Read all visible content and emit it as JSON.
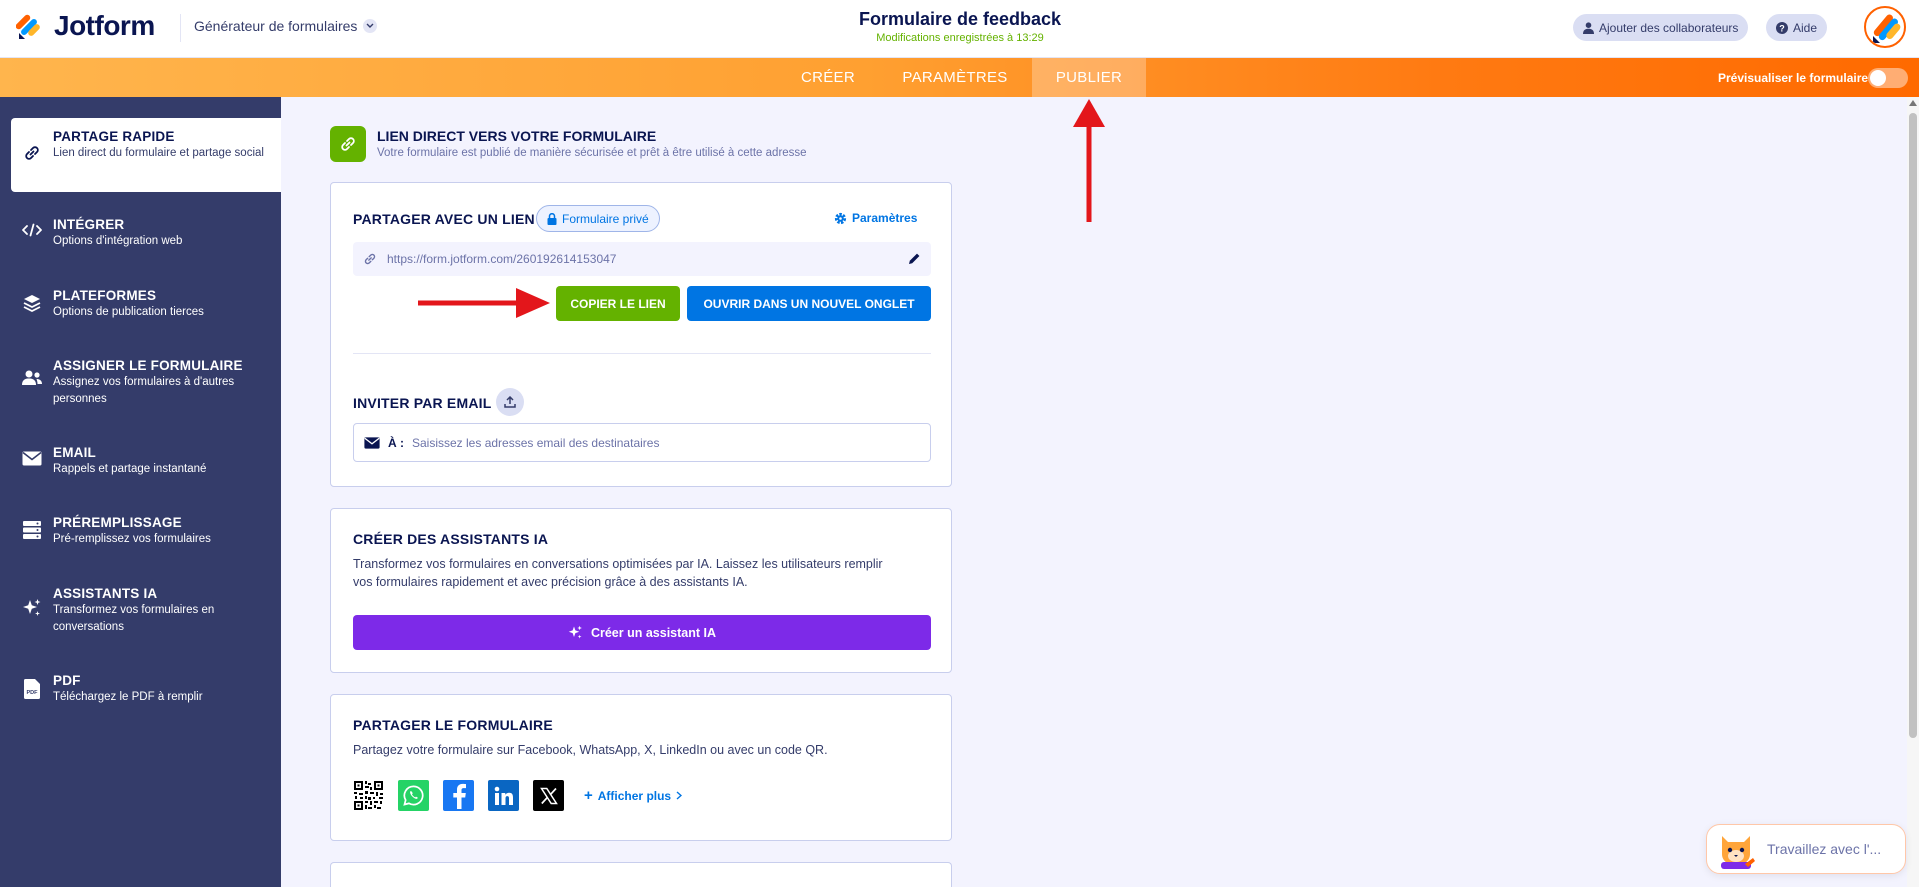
{
  "header": {
    "brand": "Jotform",
    "builder_label": "Générateur de formulaires",
    "form_title": "Formulaire de feedback",
    "save_status": "Modifications enregistrées à 13:29",
    "collab_label": "Ajouter des collaborateurs",
    "help_label": "Aide"
  },
  "nav": {
    "tabs": [
      {
        "label": "CRÉER"
      },
      {
        "label": "PARAMÈTRES"
      },
      {
        "label": "PUBLIER"
      }
    ],
    "active_tab": "PUBLIER",
    "preview_label": "Prévisualiser le formulaire"
  },
  "sidebar": {
    "items": [
      {
        "title": "PARTAGE RAPIDE",
        "subtitle": "Lien direct du formulaire et partage social",
        "icon": "link-icon",
        "active": true
      },
      {
        "title": "INTÉGRER",
        "subtitle": "Options d'intégration web",
        "icon": "code-icon"
      },
      {
        "title": "PLATEFORMES",
        "subtitle": "Options de publication tierces",
        "icon": "layers-icon"
      },
      {
        "title": "ASSIGNER LE FORMULAIRE",
        "subtitle": "Assignez vos formulaires à d'autres personnes",
        "icon": "users-icon"
      },
      {
        "title": "EMAIL",
        "subtitle": "Rappels et partage instantané",
        "icon": "envelope-icon"
      },
      {
        "title": "PRÉREMPLISSAGE",
        "subtitle": "Pré-remplissez vos formulaires",
        "icon": "stack-icon"
      },
      {
        "title": "ASSISTANTS IA",
        "subtitle": "Transformez vos formulaires en conversations",
        "icon": "sparkle-icon"
      },
      {
        "title": "PDF",
        "subtitle": "Téléchargez le PDF à remplir",
        "icon": "pdf-icon"
      }
    ]
  },
  "direct_link": {
    "title": "LIEN DIRECT VERS VOTRE FORMULAIRE",
    "subtitle": "Votre formulaire est publié de manière sécurisée et prêt à être utilisé à cette adresse"
  },
  "share_link": {
    "title": "PARTAGER AVEC UN LIEN",
    "badge": "Formulaire privé",
    "settings_label": "Paramètres",
    "url": "https://form.jotform.com/260192614153047",
    "copy_label": "COPIER LE LIEN",
    "open_label": "OUVRIR DANS UN NOUVEL ONGLET",
    "invite_title": "INVITER PAR EMAIL",
    "to_label": "À :",
    "email_placeholder": "Saisissez les adresses email des destinataires"
  },
  "ai": {
    "title": "CRÉER DES ASSISTANTS IA",
    "desc_line1": "Transformez vos formulaires en conversations optimisées par IA. Laissez les utilisateurs remplir",
    "desc_line2": "vos formulaires rapidement et avec précision grâce à des assistants IA.",
    "button_label": "Créer un assistant IA"
  },
  "share_form": {
    "title": "PARTAGER LE FORMULAIRE",
    "desc": "Partagez votre formulaire sur Facebook, WhatsApp, X, LinkedIn ou avec un code QR.",
    "socials": [
      "qr-code-icon",
      "whatsapp-icon",
      "facebook-icon",
      "linkedin-icon",
      "x-icon"
    ],
    "show_more": "Afficher plus"
  },
  "chat": {
    "text": "Travaillez avec l'..."
  },
  "colors": {
    "primary_navy": "#0a1551",
    "sidebar_bg": "#343c6a",
    "orange": "#ff6100",
    "green": "#64b200",
    "blue": "#0075e3",
    "purple": "#7d2ae8",
    "annotation_red": "#e3161b"
  }
}
